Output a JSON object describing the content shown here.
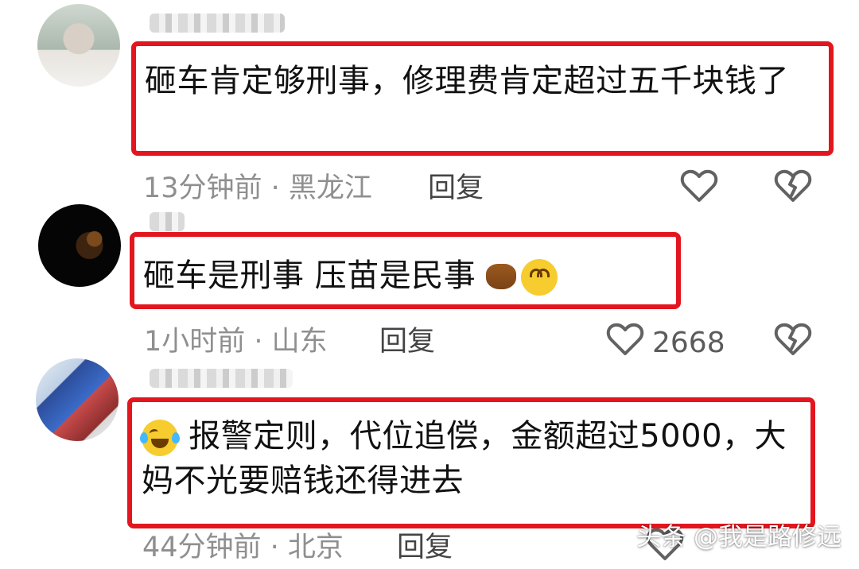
{
  "comments": [
    {
      "text": "砸车肯定够刑事，修理费肯定超过五千块钱了",
      "time_location": "13分钟前 · 黑龙江",
      "reply_label": "回复",
      "like_count": ""
    },
    {
      "text": "砸车是刑事 压苗是民事",
      "time_location": "1小时前 · 山东",
      "reply_label": "回复",
      "like_count": "2668"
    },
    {
      "text": "报警定则，代位追偿，金额超过5000，大妈不光要赔钱还得进去",
      "time_location": "44分钟前 · 北京",
      "reply_label": "回复",
      "like_count": ""
    }
  ],
  "watermark": "头条 @我是路修远",
  "colors": {
    "highlight": "#e3161f",
    "meta": "#8f8f8f",
    "text": "#111111"
  },
  "icons": {
    "like": "heart-outline-icon",
    "dislike": "broken-heart-icon",
    "emoji_1": "eye-roll-emoji-icon",
    "emoji_2": "poop-emoji-icon",
    "emoji_3": "laughing-tears-emoji-icon"
  }
}
